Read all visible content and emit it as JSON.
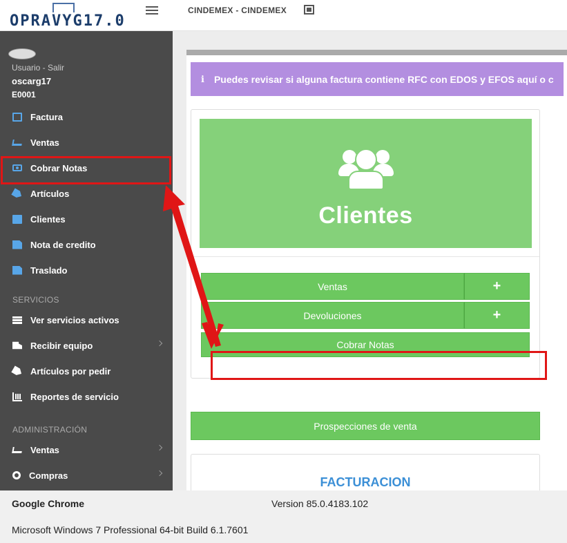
{
  "header": {
    "logo_text": "OPRAVYG17.0",
    "company": "CINDEMEX - CINDEMEX"
  },
  "user": {
    "link": "Usuario - Salir",
    "name": "oscarg17",
    "code": "E0001"
  },
  "sidebar": {
    "items": [
      {
        "label": "Factura",
        "icon": "file-code-icon"
      },
      {
        "label": "Ventas",
        "icon": "cart-icon"
      },
      {
        "label": "Cobrar Notas",
        "icon": "money-icon"
      },
      {
        "label": "Artículos",
        "icon": "tag-icon"
      },
      {
        "label": "Clientes",
        "icon": "address-book-icon"
      },
      {
        "label": "Nota de credito",
        "icon": "file-icon"
      },
      {
        "label": "Traslado",
        "icon": "file-icon"
      }
    ],
    "section_services": "SERVICIOS",
    "service_items": [
      {
        "label": "Ver servicios activos",
        "icon": "list-icon"
      },
      {
        "label": "Recibir equipo",
        "icon": "truck-icon"
      },
      {
        "label": "Artículos por pedir",
        "icon": "tags-icon"
      },
      {
        "label": "Reportes de servicio",
        "icon": "chart-icon"
      }
    ],
    "section_admin": "ADMINISTRACIÓN",
    "admin_items": [
      {
        "label": "Ventas",
        "icon": "cart-icon"
      },
      {
        "label": "Compras",
        "icon": "gear-icon"
      }
    ]
  },
  "main": {
    "info_icon": "ℹ",
    "info_text": "Puedes revisar si alguna factura contiene RFC con EDOS y EFOS aquí o c",
    "card_title": "Clientes",
    "buttons": {
      "ventas": "Ventas",
      "devoluciones": "Devoluciones",
      "plus": "+",
      "cobrar_notas": "Cobrar Notas",
      "prospecciones": "Prospecciones de venta"
    },
    "facturacion_title": "FACTURACION"
  },
  "footer": {
    "browser": "Google Chrome",
    "version": "Version 85.0.4183.102",
    "os": "Microsoft Windows 7 Professional  64-bit Build 6.1.7601"
  },
  "colors": {
    "sidebar_bg": "#4a4a4a",
    "accent_green": "#6cc85f",
    "card_green": "#85d17a",
    "info_purple": "#b38ee0",
    "highlight_red": "#e01616",
    "link_blue": "#3b8fd6"
  }
}
